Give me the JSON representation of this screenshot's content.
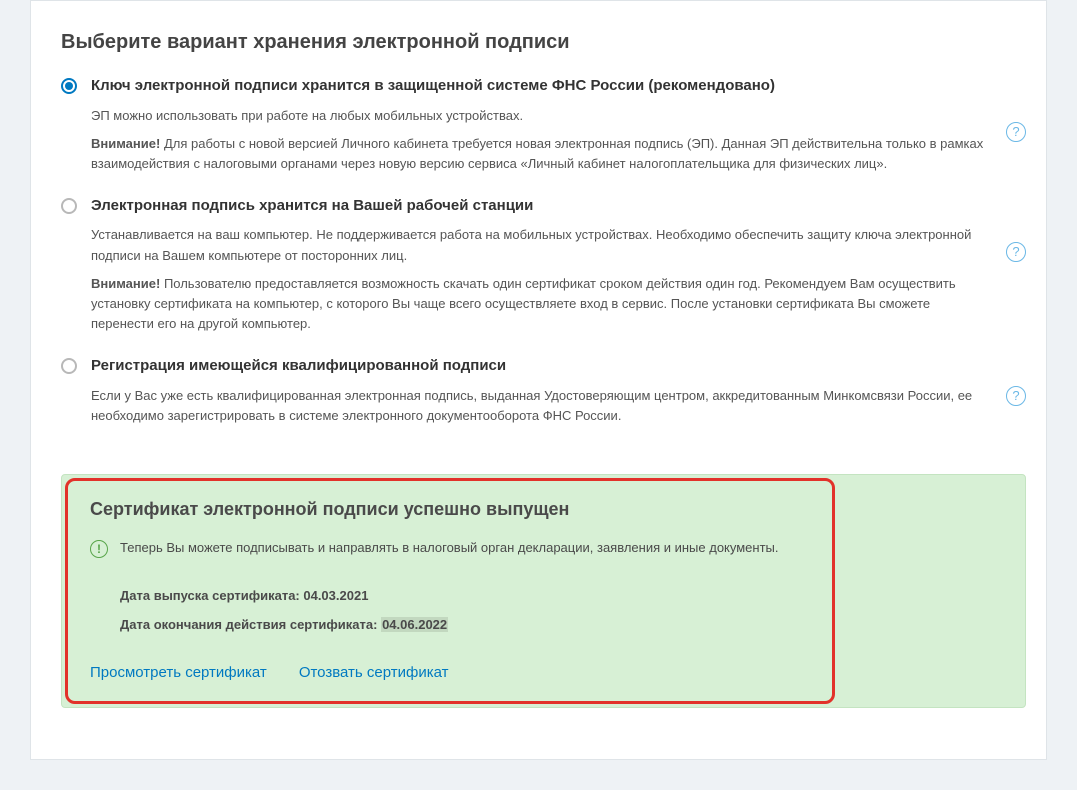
{
  "title": "Выберите вариант хранения электронной подписи",
  "warn_prefix": "Внимание!",
  "opts": [
    {
      "title": "Ключ электронной подписи хранится в защищенной системе ФНС России (рекомендовано)",
      "desc": "ЭП можно использовать при работе на любых мобильных устройствах.",
      "warn": "Для работы с новой версией Личного кабинета требуется новая электронная подпись (ЭП). Данная ЭП  действительна только в рамках взаимодействия с налоговыми органами через новую версию сервиса  «Личный кабинет налогоплательщика для физических лиц».",
      "selected": true
    },
    {
      "title": "Электронная подпись хранится на Вашей рабочей станции",
      "desc": "Устанавливается на ваш компьютер. Не поддерживается работа на мобильных устройствах. Необходимо обеспечить  защиту ключа электронной подписи на Вашем компьютере от посторонних лиц.",
      "warn": "Пользователю предоставляется возможность скачать один сертификат  сроком действия один год. Рекомендуем Вам осуществить установку сертификата на компьютер, с которого Вы  чаще всего осуществляете вход в сервис. После установки сертификата Вы сможете перенести его на другой  компьютер.",
      "selected": false
    },
    {
      "title": "Регистрация имеющейся квалифицированной подписи",
      "desc": "Если у Вас уже есть квалифицированная электронная подпись, выданная Удостоверяющим центром, аккредитованным Минкомсвязи России, ее необходимо зарегистрировать в системе электронного документооборота ФНС России.",
      "selected": false
    }
  ],
  "cert": {
    "title": "Сертификат электронной подписи успешно выпущен",
    "info": "Теперь Вы можете подписывать и направлять в налоговый орган декларации, заявления и иные документы.",
    "issue_label": "Дата выпуска сертификата: ",
    "issue_value": "04.03.2021",
    "exp_label": "Дата окончания действия сертификата: ",
    "exp_value": "04.06.2022",
    "view": "Просмотреть сертификат",
    "revoke": "Отозвать сертификат"
  },
  "help_glyph": "?",
  "info_glyph": "!"
}
